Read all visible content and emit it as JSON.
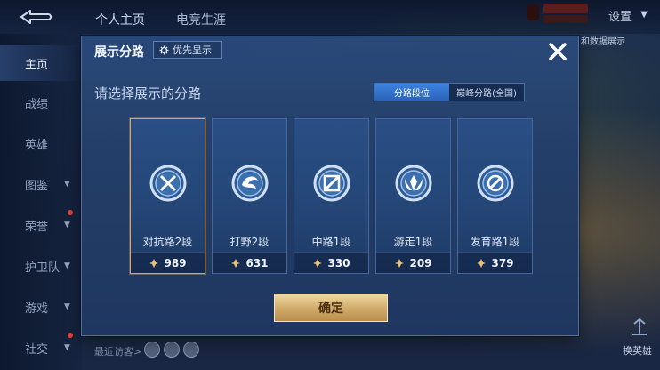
{
  "topbar": {
    "tabs": [
      "个人主页",
      "电竞生涯"
    ],
    "settings_label": "设置"
  },
  "sidebar": {
    "items": [
      {
        "label": "主页",
        "active": true,
        "chevron": false
      },
      {
        "label": "战绩",
        "active": false,
        "chevron": false
      },
      {
        "label": "英雄",
        "active": false,
        "chevron": false
      },
      {
        "label": "图鉴",
        "active": false,
        "chevron": true
      },
      {
        "label": "荣誉",
        "active": false,
        "chevron": true
      },
      {
        "label": "护卫队",
        "active": false,
        "chevron": true
      },
      {
        "label": "游戏",
        "active": false,
        "chevron": true
      },
      {
        "label": "社交",
        "active": false,
        "chevron": true
      }
    ]
  },
  "right_panel": {
    "label_partial": "和数据展示",
    "swap_hero_label": "换英雄"
  },
  "recent_visitors_label": "最近访客>",
  "modal": {
    "title": "展示分路",
    "priority_label": "优先显示",
    "subtitle": "请选择展示的分路",
    "segments": [
      "分路段位",
      "巅峰分路(全国)"
    ],
    "active_segment_index": 0,
    "cards": [
      {
        "label": "对抗路2段",
        "score": "989",
        "selected": true,
        "icon": "clash-lane-emblem-icon"
      },
      {
        "label": "打野2段",
        "score": "631",
        "selected": false,
        "icon": "jungle-emblem-icon"
      },
      {
        "label": "中路1段",
        "score": "330",
        "selected": false,
        "icon": "mid-lane-emblem-icon"
      },
      {
        "label": "游走1段",
        "score": "209",
        "selected": false,
        "icon": "roam-emblem-icon"
      },
      {
        "label": "发育路1段",
        "score": "379",
        "selected": false,
        "icon": "farm-lane-emblem-icon"
      }
    ],
    "confirm_label": "确定"
  },
  "colors": {
    "accent_gold": "#d9b46e",
    "selected_border": "#e3a35e",
    "segment_active": "#3b82e0"
  }
}
